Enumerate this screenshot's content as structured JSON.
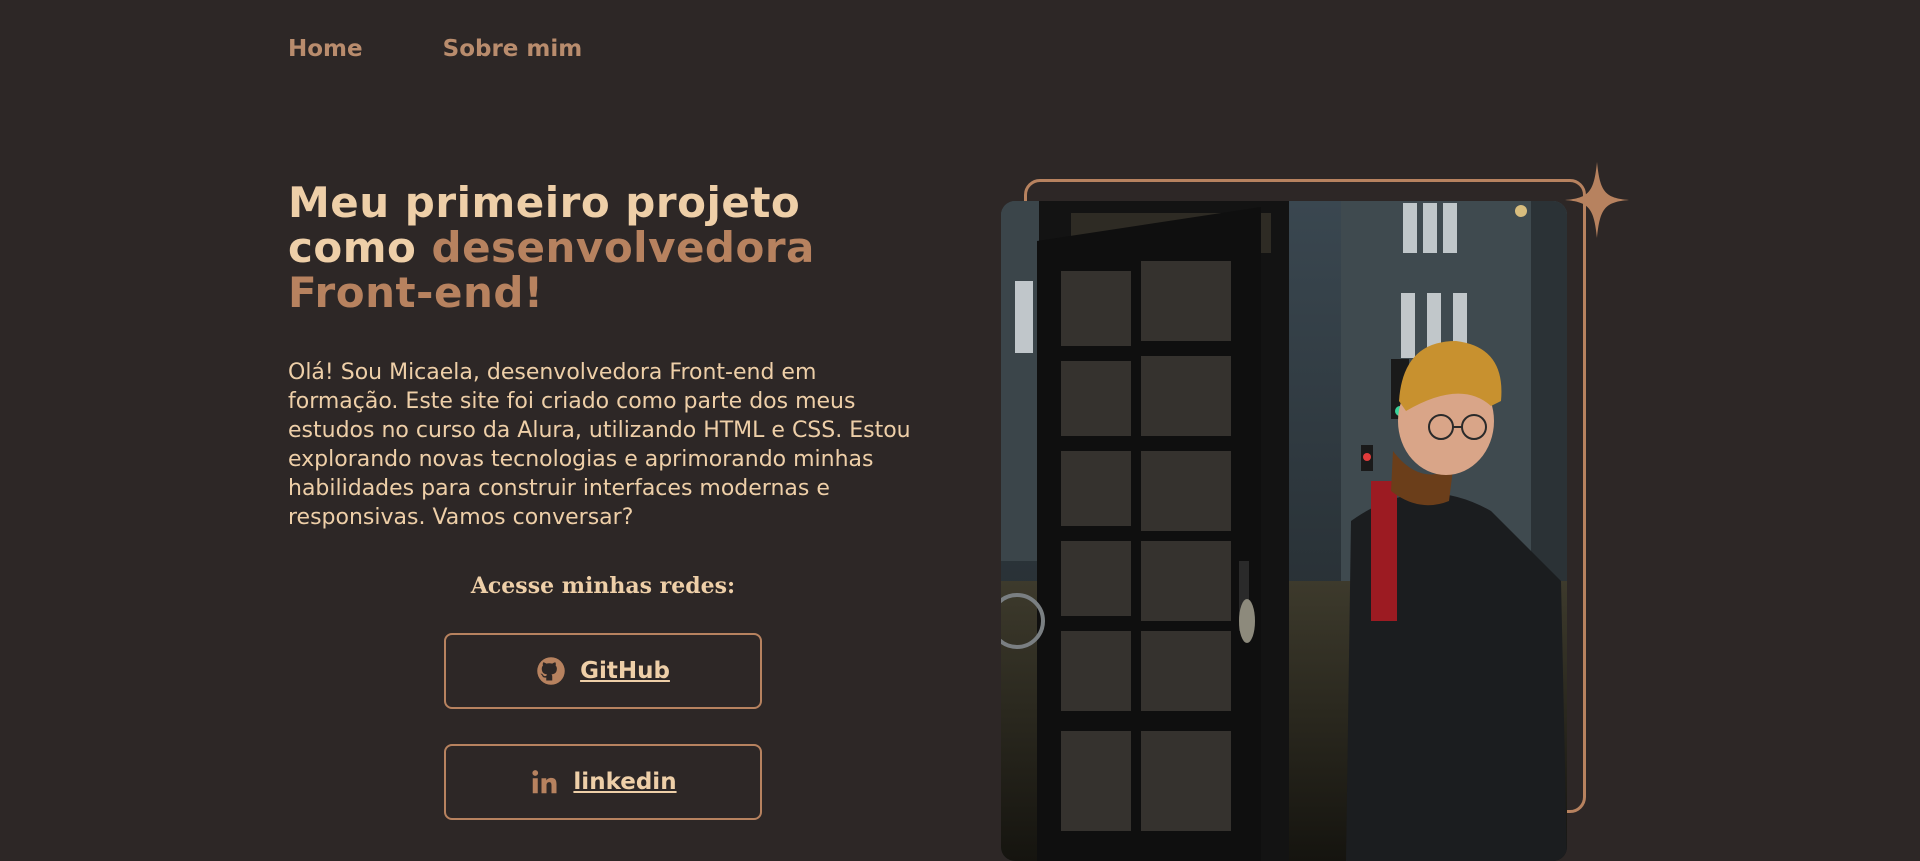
{
  "nav": {
    "home": "Home",
    "about": "Sobre mim"
  },
  "hero": {
    "title_part1": "Meu primeiro projeto como ",
    "title_accent": "desenvolvedora Front-end!",
    "intro": "Olá! Sou Micaela, desenvolvedora Front-end em formação. Este site foi criado como parte dos meus estudos no curso da Alura, utilizando HTML e CSS. Estou explorando novas tecnologias e aprimorando minhas habilidades para construir interfaces modernas e responsivas. Vamos conversar?"
  },
  "social": {
    "title": "Acesse minhas redes:",
    "github_label": "GitHub",
    "linkedin_label": "linkedin"
  },
  "colors": {
    "background": "#2d2726",
    "accent": "#b7825f",
    "text": "#eecfa8"
  },
  "icons": [
    "github-icon",
    "linkedin-icon",
    "sparkle-icon"
  ]
}
